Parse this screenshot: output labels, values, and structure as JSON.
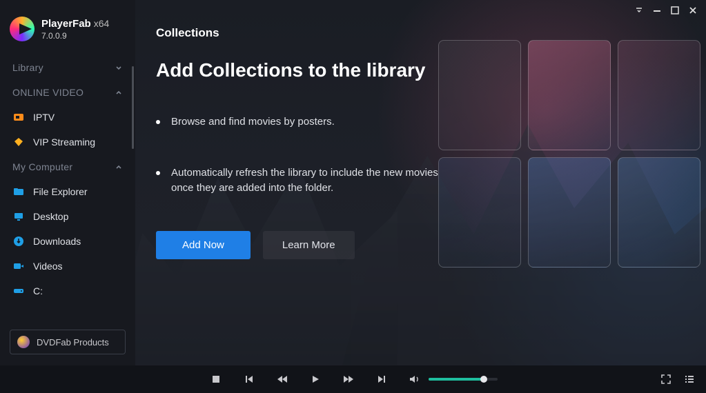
{
  "brand": {
    "name": "PlayerFab",
    "suffix": "x64",
    "version": "7.0.0.9"
  },
  "sidebar": {
    "sections": [
      {
        "label": "Library",
        "expanded": false
      },
      {
        "label": "ONLINE VIDEO",
        "expanded": true
      },
      {
        "label": "My Computer",
        "expanded": true
      }
    ],
    "online_video": [
      {
        "label": "IPTV",
        "icon": "tv"
      },
      {
        "label": "VIP Streaming",
        "icon": "diamond"
      }
    ],
    "my_computer": [
      {
        "label": "File Explorer",
        "icon": "folder"
      },
      {
        "label": "Desktop",
        "icon": "desktop"
      },
      {
        "label": "Downloads",
        "icon": "download"
      },
      {
        "label": "Videos",
        "icon": "video"
      },
      {
        "label": "C:",
        "icon": "disk"
      }
    ],
    "cta": "DVDFab Products"
  },
  "main": {
    "breadcrumb": "Collections",
    "headline": "Add Collections to the library",
    "bullets": [
      "Browse and find movies by posters.",
      "Automatically refresh the library to include the new movies once they are added into the folder."
    ],
    "primary": "Add Now",
    "secondary": "Learn More"
  },
  "player": {
    "volume_percent": 80
  },
  "icons": {
    "tv": "#ff8c1a",
    "diamond": "#ffb020",
    "folder": "#1f9fe6",
    "desktop": "#1f9fe6",
    "download": "#1f9fe6",
    "video": "#1f9fe6",
    "disk": "#1f9fe6"
  }
}
